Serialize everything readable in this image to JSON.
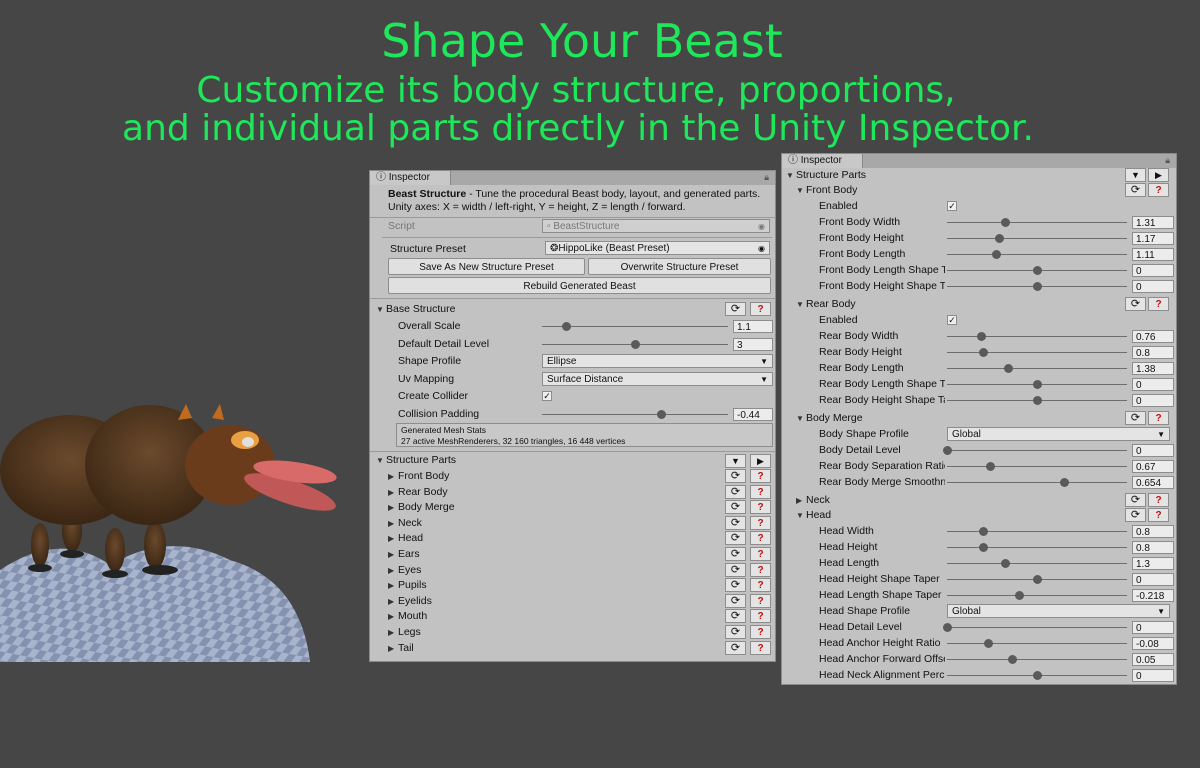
{
  "headline": {
    "line1": "Shape Your Beast",
    "line2": "Customize its body structure, proportions,",
    "line3": "and individual parts directly in the Unity Inspector."
  },
  "colors": {
    "accent": "#1ee85a",
    "background": "#464646",
    "panel": "#c2c2c2",
    "help_red": "#c01010"
  },
  "left": {
    "tab": "Inspector",
    "desc_title": "Beast Structure",
    "desc_text": " - Tune the procedural Beast body, layout, and generated parts.",
    "desc_line2": "Unity axes: X = width / left-right, Y = height, Z = length / forward.",
    "script_label": "Script",
    "script_value": "BeastStructure",
    "preset_label": "Structure Preset",
    "preset_value": "HippoLike (Beast Preset)",
    "save_btn": "Save As New Structure Preset",
    "overwrite_btn": "Overwrite Structure Preset",
    "rebuild_btn": "Rebuild Generated Beast",
    "base_section": "Base Structure",
    "base_rows": [
      {
        "label": "Overall Scale",
        "type": "slider",
        "value": "1.1",
        "pos": 0.13
      },
      {
        "label": "Default Detail Level",
        "type": "slider",
        "value": "3",
        "pos": 0.5
      },
      {
        "label": "Shape Profile",
        "type": "dropdown",
        "value": "Ellipse"
      },
      {
        "label": "Uv Mapping",
        "type": "dropdown",
        "value": "Surface Distance"
      },
      {
        "label": "Create Collider",
        "type": "check",
        "value": "✓"
      },
      {
        "label": "Collision Padding",
        "type": "slider",
        "value": "-0.44",
        "pos": 0.64
      }
    ],
    "stats_title": "Generated Mesh Stats",
    "stats_text": "27 active MeshRenderers, 32 160 triangles, 16 448 vertices",
    "parts_section": "Structure Parts",
    "parts": [
      "Front Body",
      "Rear Body",
      "Body Merge",
      "Neck",
      "Head",
      "Ears",
      "Eyes",
      "Pupils",
      "Eyelids",
      "Mouth",
      "Legs",
      "Tail"
    ]
  },
  "right": {
    "tab": "Inspector",
    "parts_section": "Structure Parts",
    "front_body": {
      "title": "Front Body",
      "rows": [
        {
          "label": "Enabled",
          "type": "check",
          "value": "✓"
        },
        {
          "label": "Front Body Width",
          "type": "slider",
          "value": "1.31",
          "pos": 0.32
        },
        {
          "label": "Front Body Height",
          "type": "slider",
          "value": "1.17",
          "pos": 0.29
        },
        {
          "label": "Front Body Length",
          "type": "slider",
          "value": "1.11",
          "pos": 0.27
        },
        {
          "label": "Front Body Length Shape Ta",
          "type": "slider",
          "value": "0",
          "pos": 0.5
        },
        {
          "label": "Front Body Height Shape Tap",
          "type": "slider",
          "value": "0",
          "pos": 0.5
        }
      ]
    },
    "rear_body": {
      "title": "Rear Body",
      "rows": [
        {
          "label": "Enabled",
          "type": "check",
          "value": "✓"
        },
        {
          "label": "Rear Body Width",
          "type": "slider",
          "value": "0.76",
          "pos": 0.19
        },
        {
          "label": "Rear Body Height",
          "type": "slider",
          "value": "0.8",
          "pos": 0.2
        },
        {
          "label": "Rear Body Length",
          "type": "slider",
          "value": "1.38",
          "pos": 0.34
        },
        {
          "label": "Rear Body Length Shape Tap",
          "type": "slider",
          "value": "0",
          "pos": 0.5
        },
        {
          "label": "Rear Body Height Shape Tap",
          "type": "slider",
          "value": "0",
          "pos": 0.5
        }
      ]
    },
    "body_merge": {
      "title": "Body Merge",
      "rows": [
        {
          "label": "Body Shape Profile",
          "type": "dropdown",
          "value": "Global"
        },
        {
          "label": "Body Detail Level",
          "type": "slider",
          "value": "0",
          "pos": 0.0
        },
        {
          "label": "Rear Body Separation Ratio",
          "type": "slider",
          "value": "0.67",
          "pos": 0.24
        },
        {
          "label": "Rear Body Merge Smoothnes",
          "type": "slider",
          "value": "0.654",
          "pos": 0.65
        }
      ]
    },
    "neck_title": "Neck",
    "head": {
      "title": "Head",
      "rows": [
        {
          "label": "Head Width",
          "type": "slider",
          "value": "0.8",
          "pos": 0.2
        },
        {
          "label": "Head Height",
          "type": "slider",
          "value": "0.8",
          "pos": 0.2
        },
        {
          "label": "Head Length",
          "type": "slider",
          "value": "1.3",
          "pos": 0.32
        },
        {
          "label": "Head Height Shape Taper",
          "type": "slider",
          "value": "0",
          "pos": 0.5
        },
        {
          "label": "Head Length Shape Taper",
          "type": "slider",
          "value": "-0.218",
          "pos": 0.4
        },
        {
          "label": "Head Shape Profile",
          "type": "dropdown",
          "value": "Global"
        },
        {
          "label": "Head Detail Level",
          "type": "slider",
          "value": "0",
          "pos": 0.0
        },
        {
          "label": "Head Anchor Height Ratio",
          "type": "slider",
          "value": "-0.08",
          "pos": 0.23
        },
        {
          "label": "Head Anchor Forward Offset",
          "type": "slider",
          "value": "0.05",
          "pos": 0.36
        },
        {
          "label": "Head Neck Alignment Percer",
          "type": "slider",
          "value": "0",
          "pos": 0.5
        }
      ]
    }
  }
}
